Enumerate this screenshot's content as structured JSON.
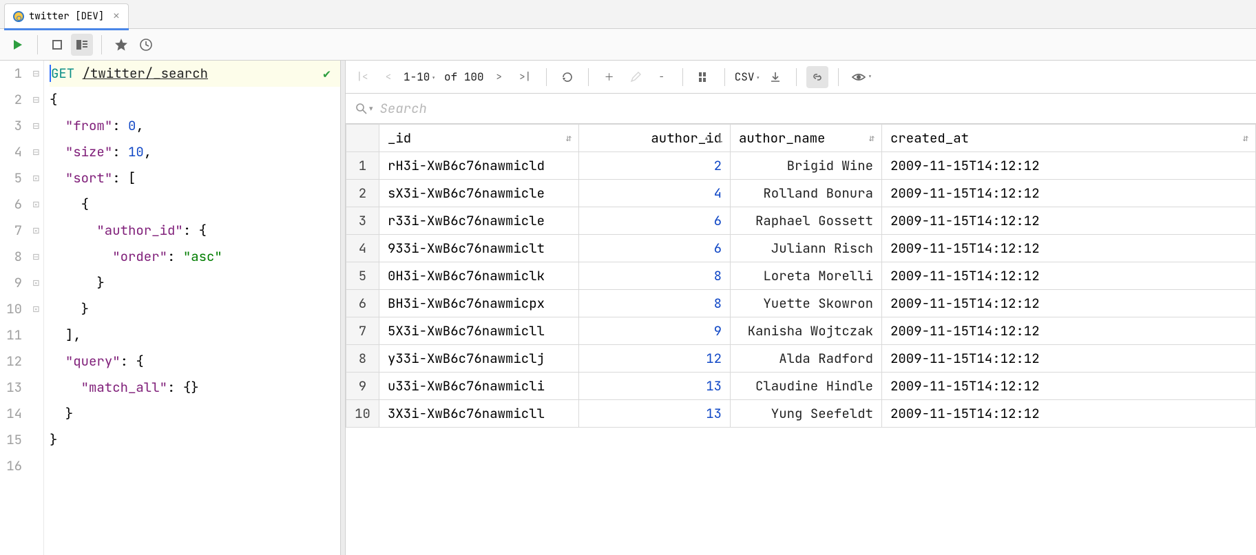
{
  "tab": {
    "title": "twitter [DEV]"
  },
  "editor": {
    "method": "GET",
    "endpoint": "/twitter/_search",
    "lines": [
      {
        "n": "1",
        "fold": ""
      },
      {
        "n": "2",
        "fold": "⊟"
      },
      {
        "n": "3",
        "fold": ""
      },
      {
        "n": "4",
        "fold": ""
      },
      {
        "n": "5",
        "fold": "⊟"
      },
      {
        "n": "6",
        "fold": "⊟"
      },
      {
        "n": "7",
        "fold": "⊟"
      },
      {
        "n": "8",
        "fold": ""
      },
      {
        "n": "9",
        "fold": "⊡"
      },
      {
        "n": "10",
        "fold": "⊡"
      },
      {
        "n": "11",
        "fold": "⊡"
      },
      {
        "n": "12",
        "fold": "⊟"
      },
      {
        "n": "13",
        "fold": ""
      },
      {
        "n": "14",
        "fold": "⊡"
      },
      {
        "n": "15",
        "fold": "⊡"
      },
      {
        "n": "16",
        "fold": ""
      }
    ],
    "body": {
      "from_key": "\"from\"",
      "from_val": "0",
      "size_key": "\"size\"",
      "size_val": "10",
      "sort_key": "\"sort\"",
      "author_id_key": "\"author_id\"",
      "order_key": "\"order\"",
      "order_val": "\"asc\"",
      "query_key": "\"query\"",
      "match_all_key": "\"match_all\""
    }
  },
  "results_toolbar": {
    "page_range": "1-10",
    "of": "of",
    "total": "100",
    "export_fmt": "CSV"
  },
  "search": {
    "placeholder": "Search"
  },
  "table": {
    "columns": [
      "_id",
      "author_id",
      "author_name",
      "created_at"
    ],
    "sort_col_idx": 1,
    "sort_dir": "asc",
    "sort_pos": "1",
    "rows": [
      {
        "n": "1",
        "_id": "rH3i-XwB6c76nawmicld",
        "author_id": "2",
        "author_name": "Brigid Wine",
        "created_at": "2009-11-15T14:12:12"
      },
      {
        "n": "2",
        "_id": "sX3i-XwB6c76nawmicle",
        "author_id": "4",
        "author_name": "Rolland Bonura",
        "created_at": "2009-11-15T14:12:12"
      },
      {
        "n": "3",
        "_id": "r33i-XwB6c76nawmicle",
        "author_id": "6",
        "author_name": "Raphael Gossett",
        "created_at": "2009-11-15T14:12:12"
      },
      {
        "n": "4",
        "_id": "933i-XwB6c76nawmiclt",
        "author_id": "6",
        "author_name": "Juliann Risch",
        "created_at": "2009-11-15T14:12:12"
      },
      {
        "n": "5",
        "_id": "0H3i-XwB6c76nawmiclk",
        "author_id": "8",
        "author_name": "Loreta Morelli",
        "created_at": "2009-11-15T14:12:12"
      },
      {
        "n": "6",
        "_id": "BH3i-XwB6c76nawmicpx",
        "author_id": "8",
        "author_name": "Yuette Skowron",
        "created_at": "2009-11-15T14:12:12"
      },
      {
        "n": "7",
        "_id": "5X3i-XwB6c76nawmicll",
        "author_id": "9",
        "author_name": "Kanisha Wojtczak",
        "created_at": "2009-11-15T14:12:12"
      },
      {
        "n": "8",
        "_id": "y33i-XwB6c76nawmiclj",
        "author_id": "12",
        "author_name": "Alda Radford",
        "created_at": "2009-11-15T14:12:12"
      },
      {
        "n": "9",
        "_id": "u33i-XwB6c76nawmicli",
        "author_id": "13",
        "author_name": "Claudine Hindle",
        "created_at": "2009-11-15T14:12:12"
      },
      {
        "n": "10",
        "_id": "3X3i-XwB6c76nawmicll",
        "author_id": "13",
        "author_name": "Yung Seefeldt",
        "created_at": "2009-11-15T14:12:12"
      }
    ]
  }
}
